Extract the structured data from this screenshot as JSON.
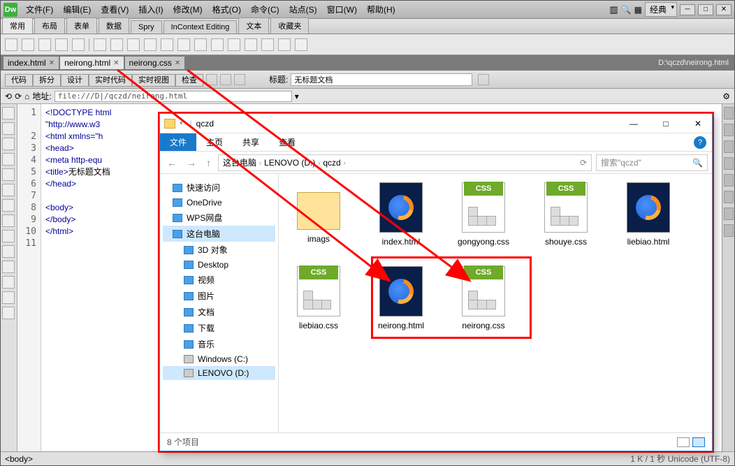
{
  "menubar": [
    "文件(F)",
    "编辑(E)",
    "查看(V)",
    "插入(I)",
    "修改(M)",
    "格式(O)",
    "命令(C)",
    "站点(S)",
    "窗口(W)",
    "帮助(H)"
  ],
  "layout_label": "经典",
  "insert_tabs": [
    "常用",
    "布局",
    "表单",
    "数据",
    "Spry",
    "InContext Editing",
    "文本",
    "收藏夹"
  ],
  "doc_tabs": [
    {
      "label": "index.html"
    },
    {
      "label": "neirong.html"
    },
    {
      "label": "neirong.css"
    }
  ],
  "doc_path": "D:\\qczd\\neirong.html",
  "view_buttons": [
    "代码",
    "拆分",
    "设计",
    "实时代码",
    "实时视图",
    "检查"
  ],
  "title_label": "标题:",
  "title_value": "无标题文档",
  "addr_label": "地址:",
  "addr_value": "file:///D|/qczd/neirong.html",
  "code_lines": [
    "<!DOCTYPE html",
    "\"http://www.w3",
    "<html xmlns=\"h",
    "<head>",
    "<meta http-equ",
    "<title>无标题文档",
    "</head>",
    "",
    "<body>",
    "</body>",
    "</html>"
  ],
  "line_numbers": [
    "1",
    "",
    "2",
    "3",
    "4",
    "5",
    "6",
    "7",
    "8",
    "9",
    "10",
    "11"
  ],
  "status_left": "<body>",
  "status_right": "1 K / 1 秒 Unicode (UTF-8)",
  "explorer": {
    "title": "qczd",
    "ribbon": [
      "文件",
      "主页",
      "共享",
      "查看"
    ],
    "breadcrumb": [
      "这台电脑",
      "LENOVO (D:)",
      "qczd"
    ],
    "search_placeholder": "搜索\"qczd\"",
    "tree": [
      {
        "label": "快速访问",
        "ic": "blue"
      },
      {
        "label": "OneDrive",
        "ic": "blue"
      },
      {
        "label": "WPS网盘",
        "ic": "blue"
      },
      {
        "label": "这台电脑",
        "ic": "blue",
        "sel": true
      },
      {
        "label": "3D 对象",
        "ic": "blue",
        "sub": true
      },
      {
        "label": "Desktop",
        "ic": "blue",
        "sub": true
      },
      {
        "label": "视频",
        "ic": "blue",
        "sub": true
      },
      {
        "label": "图片",
        "ic": "blue",
        "sub": true
      },
      {
        "label": "文档",
        "ic": "blue",
        "sub": true
      },
      {
        "label": "下载",
        "ic": "blue",
        "sub": true
      },
      {
        "label": "音乐",
        "ic": "blue",
        "sub": true
      },
      {
        "label": "Windows (C:)",
        "ic": "disk",
        "sub": true
      },
      {
        "label": "LENOVO (D:)",
        "ic": "disk",
        "sub": true,
        "sel": true
      }
    ],
    "files": [
      {
        "name": "imags",
        "type": "folder"
      },
      {
        "name": "index.html",
        "type": "html"
      },
      {
        "name": "gongyong.css",
        "type": "css"
      },
      {
        "name": "shouye.css",
        "type": "css"
      },
      {
        "name": "liebiao.html",
        "type": "html"
      },
      {
        "name": "liebiao.css",
        "type": "css"
      },
      {
        "name": "neirong.html",
        "type": "html"
      },
      {
        "name": "neirong.css",
        "type": "css"
      }
    ],
    "status": "8 个项目"
  }
}
